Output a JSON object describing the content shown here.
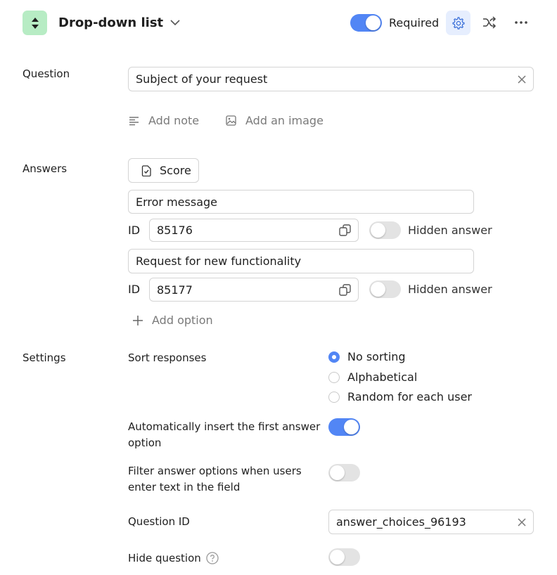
{
  "header": {
    "type_label": "Drop-down list",
    "required_label": "Required",
    "required_on": true
  },
  "question": {
    "label": "Question",
    "value": "Subject of your request",
    "add_note": "Add note",
    "add_image": "Add an image"
  },
  "answers": {
    "label": "Answers",
    "score_label": "Score",
    "id_label": "ID",
    "hidden_label": "Hidden answer",
    "items": [
      {
        "text": "Error message",
        "id": "85176",
        "hidden": false
      },
      {
        "text": "Request for new functionality",
        "id": "85177",
        "hidden": false
      }
    ],
    "add_option": "Add option"
  },
  "settings": {
    "label": "Settings",
    "sort_label": "Sort responses",
    "sort_options": [
      "No sorting",
      "Alphabetical",
      "Random for each user"
    ],
    "sort_selected": "No sorting",
    "auto_insert_label": "Automatically insert the first answer option",
    "auto_insert_on": true,
    "filter_label": "Filter answer options when users enter text in the field",
    "filter_on": false,
    "question_id_label": "Question ID",
    "question_id_value": "answer_choices_96193",
    "hide_label": "Hide question",
    "hide_on": false
  },
  "colors": {
    "accent": "#5286f5",
    "type_icon_bg": "#b7ecc4",
    "settings_btn_bg": "#e6eefe"
  }
}
